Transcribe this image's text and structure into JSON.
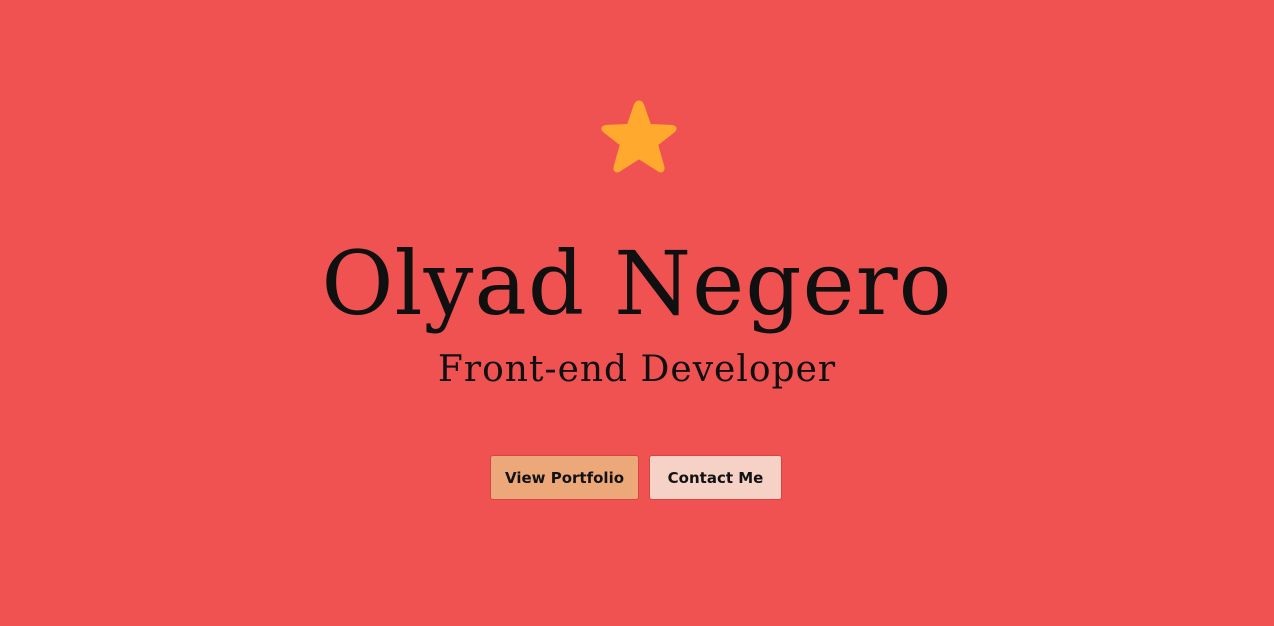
{
  "hero": {
    "icon": "star-icon",
    "name": "Olyad Negero",
    "role": "Front-end Developer"
  },
  "actions": {
    "view_portfolio_label": "View Portfolio",
    "contact_label": "Contact Me"
  },
  "colors": {
    "background": "#f05252",
    "star": "#ffa92e",
    "portfolio_button": "#eda87a",
    "contact_button": "#f5d1c6",
    "text": "#101010"
  }
}
